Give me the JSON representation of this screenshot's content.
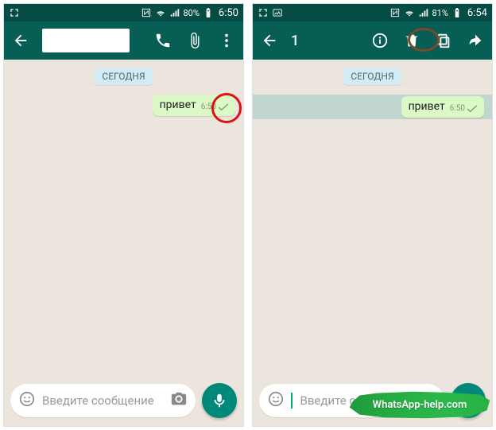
{
  "left": {
    "status": {
      "battery": "80%",
      "time": "6:50"
    },
    "date_chip": "СЕГОДНЯ",
    "message": {
      "text": "привет",
      "time": "6:50"
    },
    "input_placeholder": "Введите сообщение"
  },
  "right": {
    "status": {
      "battery": "81%",
      "time": "6:54"
    },
    "selection_count": "1",
    "date_chip": "СЕГОДНЯ",
    "message": {
      "text": "привет",
      "time": "6:50"
    },
    "input_placeholder": "Введите со"
  },
  "watermark": "WhatsApp-help.com"
}
